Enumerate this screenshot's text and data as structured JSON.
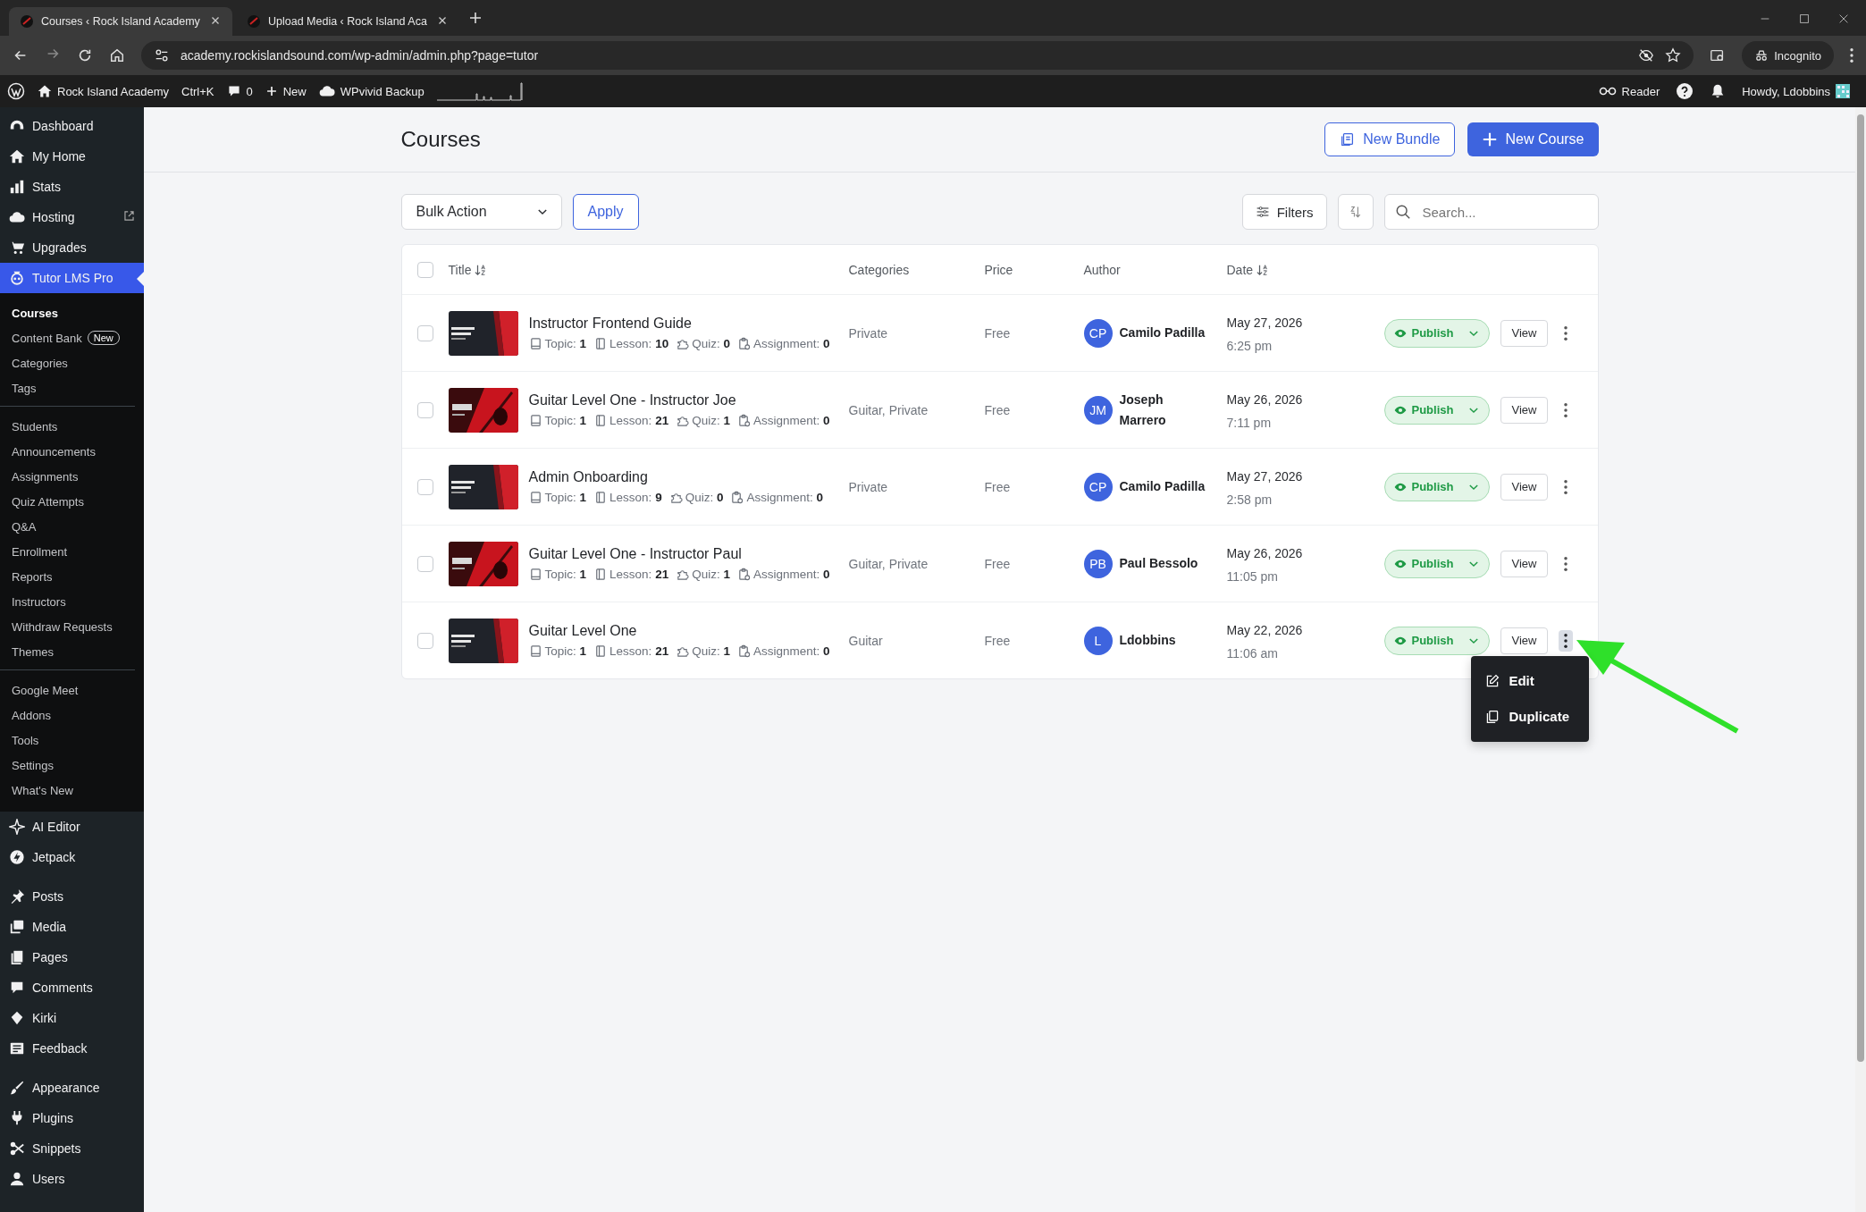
{
  "browser": {
    "tabs": [
      {
        "title": "Courses ‹ Rock Island Academy",
        "selected": true
      },
      {
        "title": "Upload Media ‹ Rock Island Aca",
        "selected": false
      }
    ],
    "url": "academy.rockislandsound.com/wp-admin/admin.php?page=tutor",
    "profile": "Incognito"
  },
  "admin_bar": {
    "site": "Rock Island Academy",
    "shortcut": "Ctrl+K",
    "comments": "0",
    "new": "New",
    "backup": "WPvivid Backup",
    "reader": "Reader",
    "greeting": "Howdy, Ldobbins"
  },
  "sidebar": {
    "groups": [
      {
        "items": [
          {
            "label": "Dashboard",
            "selected": false,
            "external": false
          },
          {
            "label": "My Home",
            "selected": false,
            "external": false
          },
          {
            "label": "Stats",
            "selected": false,
            "external": false
          },
          {
            "label": "Hosting",
            "selected": false,
            "external": true
          },
          {
            "label": "Upgrades",
            "selected": false,
            "external": false
          },
          {
            "label": "Tutor LMS Pro",
            "selected": true,
            "external": false,
            "submenu": {
              "groups": [
                {
                  "items": [
                    {
                      "label": "Courses",
                      "selected": true
                    },
                    {
                      "label": "Content Bank",
                      "selected": false,
                      "badge": "New"
                    },
                    {
                      "label": "Categories",
                      "selected": false
                    },
                    {
                      "label": "Tags",
                      "selected": false
                    }
                  ]
                },
                {
                  "items": [
                    {
                      "label": "Students",
                      "selected": false
                    },
                    {
                      "label": "Announcements",
                      "selected": false
                    },
                    {
                      "label": "Assignments",
                      "selected": false
                    },
                    {
                      "label": "Quiz Attempts",
                      "selected": false
                    },
                    {
                      "label": "Q&A",
                      "selected": false
                    },
                    {
                      "label": "Enrollment",
                      "selected": false
                    },
                    {
                      "label": "Reports",
                      "selected": false
                    },
                    {
                      "label": "Instructors",
                      "selected": false
                    },
                    {
                      "label": "Withdraw Requests",
                      "selected": false
                    },
                    {
                      "label": "Themes",
                      "selected": false
                    }
                  ]
                },
                {
                  "items": [
                    {
                      "label": "Google Meet",
                      "selected": false
                    },
                    {
                      "label": "Addons",
                      "selected": false
                    },
                    {
                      "label": "Tools",
                      "selected": false
                    },
                    {
                      "label": "Settings",
                      "selected": false
                    },
                    {
                      "label": "What's New",
                      "selected": false
                    }
                  ]
                }
              ]
            }
          },
          {
            "label": "AI Editor",
            "selected": false,
            "external": false
          },
          {
            "label": "Jetpack",
            "selected": false,
            "external": false
          }
        ]
      },
      {
        "items": [
          {
            "label": "Posts",
            "selected": false,
            "external": false
          },
          {
            "label": "Media",
            "selected": false,
            "external": false
          },
          {
            "label": "Pages",
            "selected": false,
            "external": false
          },
          {
            "label": "Comments",
            "selected": false,
            "external": false
          },
          {
            "label": "Kirki",
            "selected": false,
            "external": false
          },
          {
            "label": "Feedback",
            "selected": false,
            "external": false
          }
        ]
      },
      {
        "items": [
          {
            "label": "Appearance",
            "selected": false,
            "external": false
          },
          {
            "label": "Plugins",
            "selected": false,
            "external": false
          },
          {
            "label": "Snippets",
            "selected": false,
            "external": false
          },
          {
            "label": "Users",
            "selected": false,
            "external": false
          }
        ]
      }
    ]
  },
  "page": {
    "title": "Courses",
    "new_bundle": "New Bundle",
    "new_course": "New Course"
  },
  "toolbar": {
    "bulk_action": "Bulk Action",
    "apply": "Apply",
    "filters": "Filters",
    "search": {
      "placeholder": "Search..."
    }
  },
  "table": {
    "select_all_checked": false,
    "columns": [
      "Title",
      "Categories",
      "Price",
      "Author",
      "Date"
    ],
    "rows": [
      {
        "checked": false,
        "title": "Instructor Frontend Guide",
        "stats": [
          {
            "label": "Topic:",
            "value": "1"
          },
          {
            "label": "Lesson:",
            "value": "10"
          },
          {
            "label": "Quiz:",
            "value": "0"
          },
          {
            "label": "Assignment:",
            "value": "0"
          }
        ],
        "categories": "Private",
        "price": "Free",
        "initials": "CP",
        "author": "Camilo Padilla",
        "date": "May 27, 2026",
        "time": "6:25 pm",
        "status": "Publish",
        "view": "View",
        "menu_open": false
      },
      {
        "checked": false,
        "title": "Guitar Level One - Instructor Joe",
        "stats": [
          {
            "label": "Topic:",
            "value": "1"
          },
          {
            "label": "Lesson:",
            "value": "21"
          },
          {
            "label": "Quiz:",
            "value": "1"
          },
          {
            "label": "Assignment:",
            "value": "0"
          }
        ],
        "categories": "Guitar, Private",
        "price": "Free",
        "initials": "JM",
        "author": "Joseph Marrero",
        "date": "May 26, 2026",
        "time": "7:11 pm",
        "status": "Publish",
        "view": "View",
        "menu_open": false
      },
      {
        "checked": false,
        "title": "Admin Onboarding",
        "stats": [
          {
            "label": "Topic:",
            "value": "1"
          },
          {
            "label": "Lesson:",
            "value": "9"
          },
          {
            "label": "Quiz:",
            "value": "0"
          },
          {
            "label": "Assignment:",
            "value": "0"
          }
        ],
        "categories": "Private",
        "price": "Free",
        "initials": "CP",
        "author": "Camilo Padilla",
        "date": "May 27, 2026",
        "time": "2:58 pm",
        "status": "Publish",
        "view": "View",
        "menu_open": false
      },
      {
        "checked": false,
        "title": "Guitar Level One - Instructor Paul",
        "stats": [
          {
            "label": "Topic:",
            "value": "1"
          },
          {
            "label": "Lesson:",
            "value": "21"
          },
          {
            "label": "Quiz:",
            "value": "1"
          },
          {
            "label": "Assignment:",
            "value": "0"
          }
        ],
        "categories": "Guitar, Private",
        "price": "Free",
        "initials": "PB",
        "author": "Paul Bessolo",
        "date": "May 26, 2026",
        "time": "11:05 pm",
        "status": "Publish",
        "view": "View",
        "menu_open": false
      },
      {
        "checked": false,
        "title": "Guitar Level One",
        "stats": [
          {
            "label": "Topic:",
            "value": "1"
          },
          {
            "label": "Lesson:",
            "value": "21"
          },
          {
            "label": "Quiz:",
            "value": "1"
          },
          {
            "label": "Assignment:",
            "value": "0"
          }
        ],
        "categories": "Guitar",
        "price": "Free",
        "initials": "L",
        "author": "Ldobbins",
        "date": "May 22, 2026",
        "time": "11:06 am",
        "status": "Publish",
        "view": "View",
        "menu_open": true
      }
    ],
    "row_menu": [
      "Edit",
      "Duplicate"
    ]
  }
}
